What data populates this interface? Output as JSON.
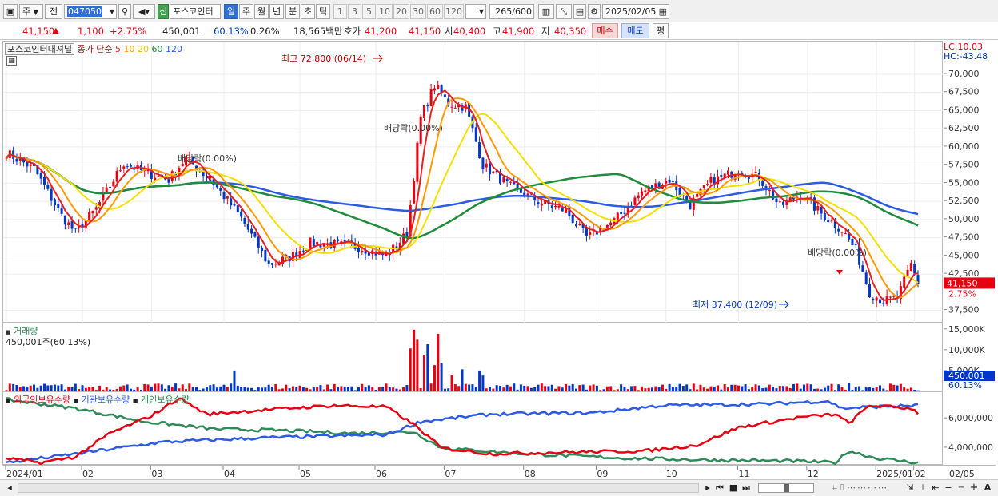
{
  "toolbar": {
    "mode_labels": [
      "주",
      "전"
    ],
    "code": "047050",
    "market_badge": "신",
    "stock_name": "포스코인터",
    "period_tabs": [
      "일",
      "주",
      "월",
      "년",
      "분",
      "초",
      "틱"
    ],
    "multipliers": [
      "1",
      "3",
      "5",
      "10",
      "20",
      "30",
      "60",
      "120"
    ],
    "count": "265",
    "count_max": "/600",
    "date": "2025/02/05"
  },
  "quote": {
    "price": "41,150",
    "change_arrow": "▲",
    "change": "1,100",
    "change_pct": "+2.75%",
    "volume": "450,001",
    "volume_ratio": "60.13%",
    "turnover": "0.26%",
    "amount": "18,565백만",
    "ask_label": "호가",
    "ask": "41,200",
    "bid": "41,150",
    "open_label": "시",
    "open": "40,400",
    "high_label": "고",
    "high": "41,900",
    "low_label": "저",
    "low": "40,350",
    "buy_label": "매수",
    "sell_label": "매도",
    "avg_label": "평"
  },
  "price_pane": {
    "title": "포스코인터내셔널",
    "ma_label": "종가 단순",
    "ma_periods": [
      "5",
      "10",
      "20",
      "60",
      "120"
    ],
    "ma_colors": [
      "#e62020",
      "#ff9900",
      "#f4e000",
      "#1e8c3a",
      "#2b5ae6"
    ],
    "lc": "LC:10.03",
    "hc": "HC:-43.48",
    "high_note": "최고 72,800 (06/14)",
    "low_note": "최저 37,400 (12/09)",
    "dividend_notes": [
      "배당락(0.00%)",
      "배당락(0.00%)",
      "배당락(0.00%)"
    ],
    "current_price_tag": "41,150",
    "current_pct_tag": "2.75%",
    "y_ticks": [
      "70,000",
      "67,500",
      "65,000",
      "62,500",
      "60,000",
      "57,500",
      "55,000",
      "52,500",
      "50,000",
      "47,500",
      "45,000",
      "42,500",
      "37,500"
    ]
  },
  "volume_pane": {
    "title": "거래량",
    "value_text": "450,001주(60.13%)",
    "y_ticks": [
      "15,000K",
      "10,000K",
      "5,000K"
    ],
    "current_tag": "450,001",
    "current_pct_tag": "60.13%"
  },
  "holding_pane": {
    "legend": [
      "외국인보유수량",
      "기관보유수량",
      "개인보유수량"
    ],
    "legend_colors": [
      "#e60012",
      "#2b5ae6",
      "#2e8b57"
    ],
    "y_ticks": [
      "6,000,000",
      "4,000,000"
    ]
  },
  "x_axis": {
    "labels": [
      "2024/01",
      "02",
      "03",
      "04",
      "05",
      "06",
      "07",
      "08",
      "09",
      "10",
      "11",
      "12",
      "2025/01",
      "02"
    ],
    "right_label": "02/05"
  },
  "bottom": {
    "icons": [
      "play-icon",
      "rewind-icon",
      "stop-icon",
      "forward-icon"
    ],
    "zoom_minus": "−",
    "zoom_plus": "+",
    "text_tool": "A"
  }
}
